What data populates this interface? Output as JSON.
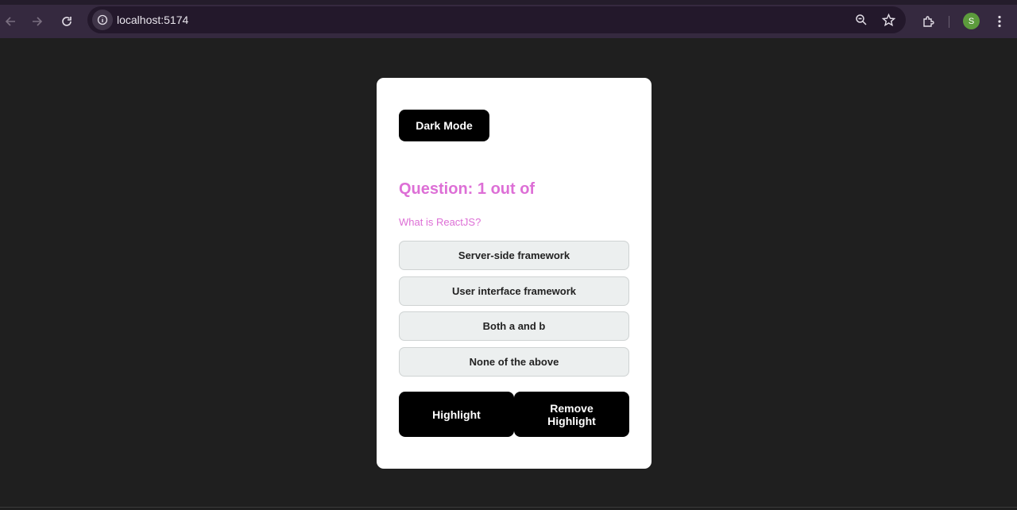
{
  "browser": {
    "url": "localhost:5174",
    "profile_initial": "S"
  },
  "quiz": {
    "dark_mode_label": "Dark Mode",
    "question_heading": "Question: 1 out of",
    "question_text": "What is ReactJS?",
    "options": [
      "Server-side framework",
      "User interface framework",
      "Both a and b",
      "None of the above"
    ],
    "highlight_label": "Highlight",
    "remove_highlight_label": "Remove Highlight"
  },
  "colors": {
    "page_background": "#1f1f1f",
    "toolbar": "#35293f",
    "accent_pink": "#dd6fd6",
    "button_black": "#000000",
    "option_background": "#ecefef"
  }
}
